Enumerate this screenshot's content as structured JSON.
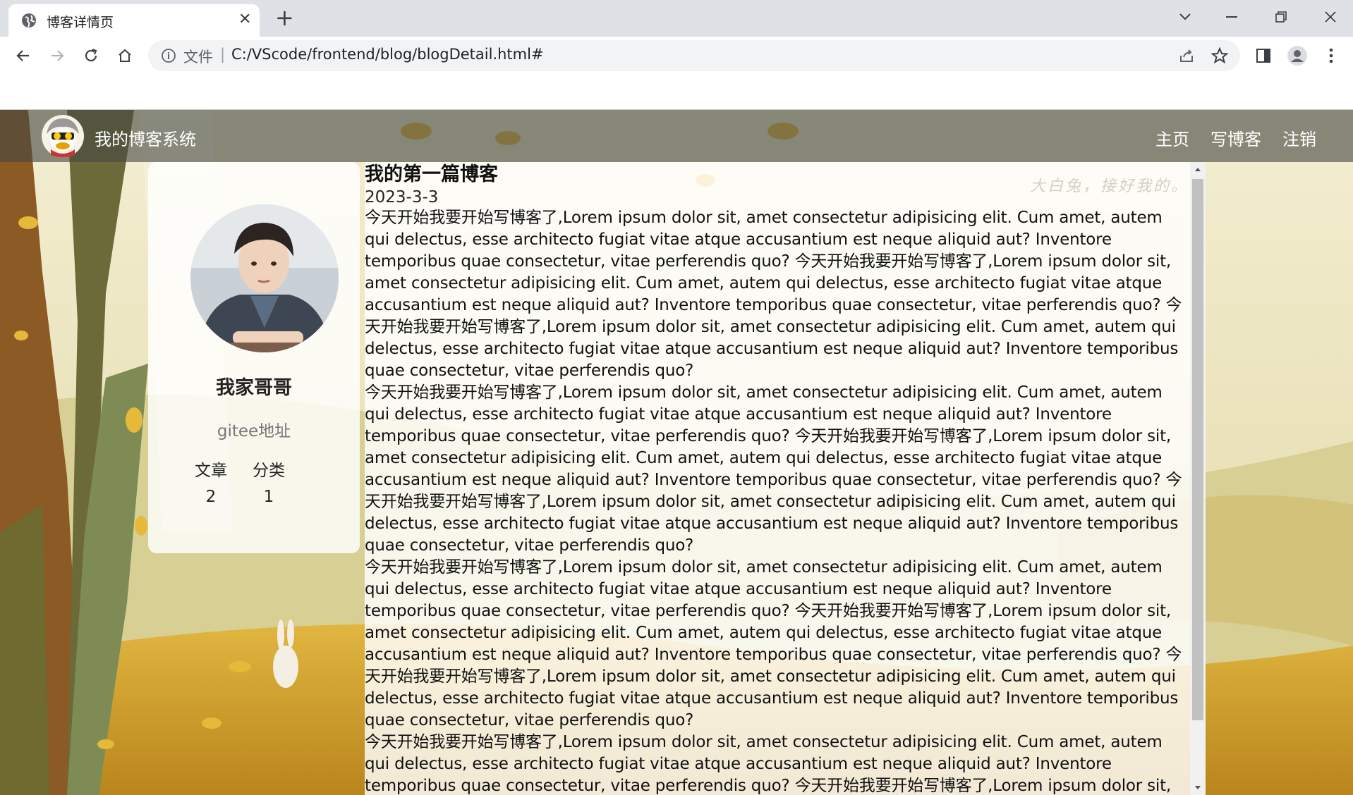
{
  "browser": {
    "tab_title": "博客详情页",
    "url_scheme_label": "文件",
    "url_separator": "|",
    "url": "C:/VScode/frontend/blog/blogDetail.html#"
  },
  "nav": {
    "site_title": "我的博客系统",
    "links": [
      "主页",
      "写博客",
      "注销"
    ]
  },
  "author": {
    "name": "我家哥哥",
    "gitee_label": "gitee地址",
    "stats": [
      {
        "label": "文章",
        "value": "2"
      },
      {
        "label": "分类",
        "value": "1"
      }
    ]
  },
  "watermark": "大白兔，接好我的。",
  "blog": {
    "title": "我的第一篇博客",
    "date": "2023-3-3",
    "paragraphs": [
      "今天开始我要开始写博客了,Lorem ipsum dolor sit, amet consectetur adipisicing elit. Cum amet, autem qui delectus, esse architecto fugiat vitae atque accusantium est neque aliquid aut? Inventore temporibus quae consectetur, vitae perferendis quo? 今天开始我要开始写博客了,Lorem ipsum dolor sit, amet consectetur adipisicing elit. Cum amet, autem qui delectus, esse architecto fugiat vitae atque accusantium est neque aliquid aut? Inventore temporibus quae consectetur, vitae perferendis quo? 今天开始我要开始写博客了,Lorem ipsum dolor sit, amet consectetur adipisicing elit. Cum amet, autem qui delectus, esse architecto fugiat vitae atque accusantium est neque aliquid aut? Inventore temporibus quae consectetur, vitae perferendis quo?",
      "今天开始我要开始写博客了,Lorem ipsum dolor sit, amet consectetur adipisicing elit. Cum amet, autem qui delectus, esse architecto fugiat vitae atque accusantium est neque aliquid aut? Inventore temporibus quae consectetur, vitae perferendis quo? 今天开始我要开始写博客了,Lorem ipsum dolor sit, amet consectetur adipisicing elit. Cum amet, autem qui delectus, esse architecto fugiat vitae atque accusantium est neque aliquid aut? Inventore temporibus quae consectetur, vitae perferendis quo? 今天开始我要开始写博客了,Lorem ipsum dolor sit, amet consectetur adipisicing elit. Cum amet, autem qui delectus, esse architecto fugiat vitae atque accusantium est neque aliquid aut? Inventore temporibus quae consectetur, vitae perferendis quo?",
      "今天开始我要开始写博客了,Lorem ipsum dolor sit, amet consectetur adipisicing elit. Cum amet, autem qui delectus, esse architecto fugiat vitae atque accusantium est neque aliquid aut? Inventore temporibus quae consectetur, vitae perferendis quo? 今天开始我要开始写博客了,Lorem ipsum dolor sit, amet consectetur adipisicing elit. Cum amet, autem qui delectus, esse architecto fugiat vitae atque accusantium est neque aliquid aut? Inventore temporibus quae consectetur, vitae perferendis quo? 今天开始我要开始写博客了,Lorem ipsum dolor sit, amet consectetur adipisicing elit. Cum amet, autem qui delectus, esse architecto fugiat vitae atque accusantium est neque aliquid aut? Inventore temporibus quae consectetur, vitae perferendis quo?",
      "今天开始我要开始写博客了,Lorem ipsum dolor sit, amet consectetur adipisicing elit. Cum amet, autem qui delectus, esse architecto fugiat vitae atque accusantium est neque aliquid aut? Inventore temporibus quae consectetur, vitae perferendis quo? 今天开始我要开始写博客了,Lorem ipsum dolor sit,"
    ]
  }
}
